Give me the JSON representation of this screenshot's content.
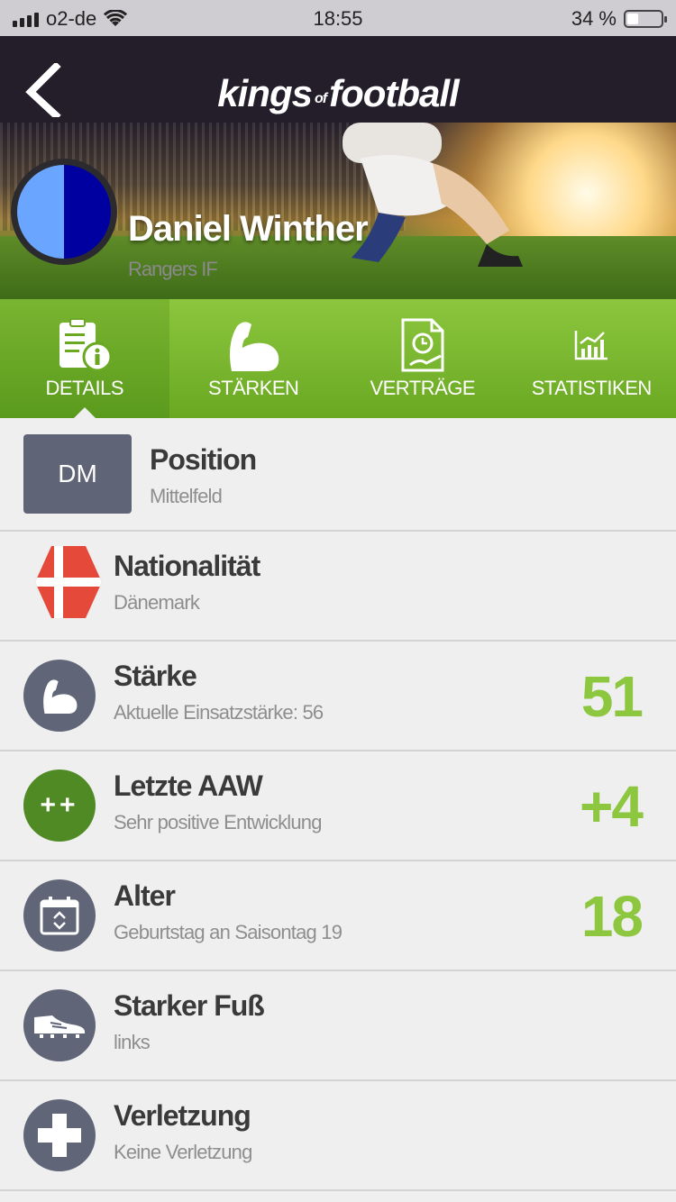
{
  "status": {
    "carrier": "o2-de",
    "time": "18:55",
    "battery": "34 %"
  },
  "header": {
    "logo_kings": "kings",
    "logo_of": "of",
    "logo_football": "football"
  },
  "player": {
    "name": "Daniel Winther",
    "club": "Rangers IF",
    "crest_colors": [
      "#6aa6ff",
      "#0000a0"
    ]
  },
  "tabs": [
    {
      "label": "DETAILS",
      "icon": "details-icon",
      "active": true
    },
    {
      "label": "STÄRKEN",
      "icon": "biceps-icon"
    },
    {
      "label": "VERTRÄGE",
      "icon": "contract-icon"
    },
    {
      "label": "STATISTIKEN",
      "icon": "chart-icon"
    }
  ],
  "details": {
    "position": {
      "badge": "DM",
      "title": "Position",
      "sub": "Mittelfeld"
    },
    "nationality": {
      "title": "Nationalität",
      "sub": "Dänemark",
      "flag_colors": [
        "#e5493a",
        "#ffffff"
      ]
    },
    "strength": {
      "title": "Stärke",
      "sub": "Aktuelle Einsatzstärke: 56",
      "value": "51"
    },
    "aaw": {
      "icon_text": "++",
      "title": "Letzte AAW",
      "sub": "Sehr positive Entwicklung",
      "value": "+4"
    },
    "age": {
      "title": "Alter",
      "sub": "Geburtstag an Saisontag 19",
      "value": "18"
    },
    "foot": {
      "title": "Starker Fuß",
      "sub": "links"
    },
    "injury": {
      "title": "Verletzung",
      "sub": "Keine Verletzung"
    }
  },
  "colors": {
    "accent": "#8dc63f",
    "nav": "#231e2a",
    "icon_bg": "#606578",
    "aaw_bg": "#4f8a24"
  }
}
